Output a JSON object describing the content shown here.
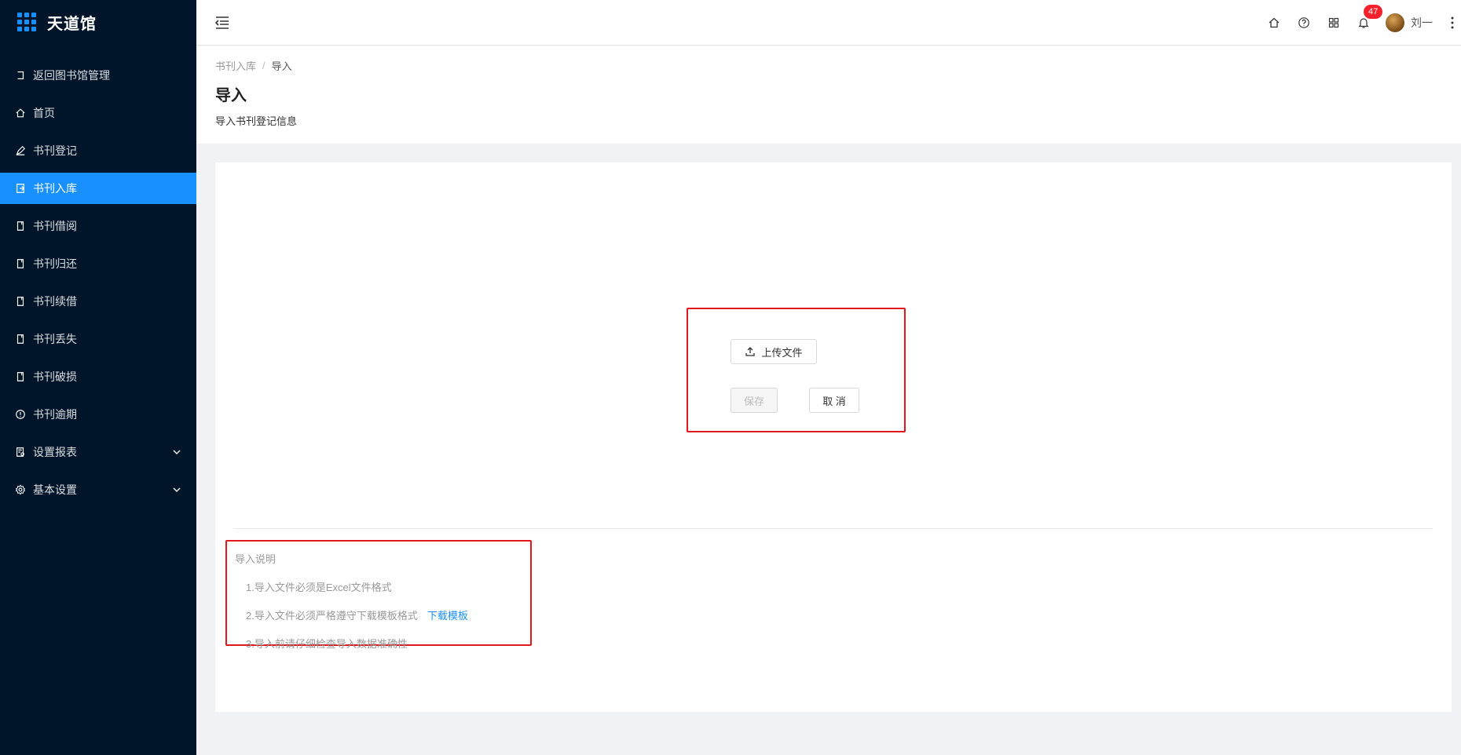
{
  "app": {
    "title": "天道馆"
  },
  "sidebar": {
    "items": [
      {
        "label": "返回图书馆管理",
        "icon": "back-icon"
      },
      {
        "label": "首页",
        "icon": "home-icon"
      },
      {
        "label": "书刊登记",
        "icon": "edit-icon"
      },
      {
        "label": "书刊入库",
        "icon": "import-icon",
        "active": true
      },
      {
        "label": "书刊借阅",
        "icon": "book-icon"
      },
      {
        "label": "书刊归还",
        "icon": "book-icon"
      },
      {
        "label": "书刊续借",
        "icon": "book-icon"
      },
      {
        "label": "书刊丢失",
        "icon": "book-icon"
      },
      {
        "label": "书刊破损",
        "icon": "book-icon"
      },
      {
        "label": "书刊逾期",
        "icon": "info-circle-icon"
      },
      {
        "label": "设置报表",
        "icon": "report-icon",
        "expandable": true
      },
      {
        "label": "基本设置",
        "icon": "gear-icon",
        "expandable": true
      }
    ]
  },
  "header": {
    "notification_count": "47",
    "username": "刘一"
  },
  "breadcrumb": {
    "parent": "书刊入库",
    "separator": "/",
    "current": "导入"
  },
  "page": {
    "title": "导入",
    "description": "导入书刊登记信息"
  },
  "upload": {
    "upload_label": "上传文件",
    "save_label": "保存",
    "cancel_label": "取 消"
  },
  "notes": {
    "title": "导入说明",
    "items": [
      "1.导入文件必须是Excel文件格式",
      "2.导入文件必须严格遵守下载模板格式",
      "3.导入前请仔细检查导入数据准确性"
    ],
    "download_link": "下载模板"
  },
  "colors": {
    "sidebar_bg": "#001529",
    "accent": "#1890ff",
    "highlight_border": "#e0171c",
    "badge": "#f5222d"
  }
}
